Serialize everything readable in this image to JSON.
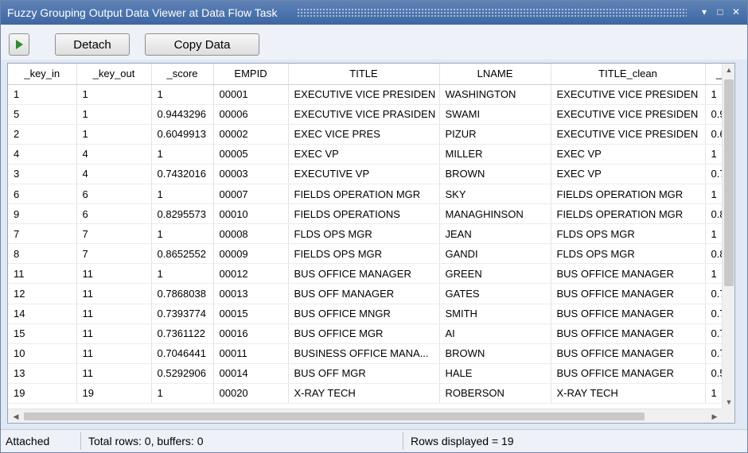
{
  "window": {
    "title": "Fuzzy Grouping Output Data Viewer at Data Flow Task",
    "controls": {
      "dropdown": "▾",
      "maximize": "□",
      "close": "✕"
    }
  },
  "toolbar": {
    "detach_label": "Detach",
    "copy_label": "Copy Data"
  },
  "grid": {
    "columns": [
      "_key_in",
      "_key_out",
      "_score",
      "EMPID",
      "TITLE",
      "LNAME",
      "TITLE_clean",
      "_S"
    ],
    "rows": [
      [
        "1",
        "1",
        "1",
        "00001",
        "EXECUTIVE VICE PRESIDEN",
        "WASHINGTON",
        "EXECUTIVE VICE PRESIDEN",
        "1"
      ],
      [
        "5",
        "1",
        "0.9443296",
        "00006",
        "EXECUTIVE VICE PRASIDEN",
        "SWAMI",
        "EXECUTIVE VICE PRESIDEN",
        "0.9"
      ],
      [
        "2",
        "1",
        "0.6049913",
        "00002",
        "EXEC VICE PRES",
        "PIZUR",
        "EXECUTIVE VICE PRESIDEN",
        "0.6"
      ],
      [
        "4",
        "4",
        "1",
        "00005",
        "EXEC VP",
        "MILLER",
        "EXEC VP",
        "1"
      ],
      [
        "3",
        "4",
        "0.7432016",
        "00003",
        "EXECUTIVE VP",
        "BROWN",
        "EXEC VP",
        "0.7"
      ],
      [
        "6",
        "6",
        "1",
        "00007",
        "FIELDS OPERATION MGR",
        "SKY",
        "FIELDS OPERATION MGR",
        "1"
      ],
      [
        "9",
        "6",
        "0.8295573",
        "00010",
        "FIELDS OPERATIONS",
        "MANAGHINSON",
        "FIELDS OPERATION MGR",
        "0.8"
      ],
      [
        "7",
        "7",
        "1",
        "00008",
        "FLDS OPS MGR",
        "JEAN",
        "FLDS OPS MGR",
        "1"
      ],
      [
        "8",
        "7",
        "0.8652552",
        "00009",
        "FIELDS OPS MGR",
        "GANDI",
        "FLDS OPS MGR",
        "0.8"
      ],
      [
        "11",
        "11",
        "1",
        "00012",
        "BUS OFFICE MANAGER",
        "GREEN",
        "BUS OFFICE MANAGER",
        "1"
      ],
      [
        "12",
        "11",
        "0.7868038",
        "00013",
        "BUS OFF MANAGER",
        "GATES",
        "BUS OFFICE MANAGER",
        "0.7"
      ],
      [
        "14",
        "11",
        "0.7393774",
        "00015",
        "BUS OFFICE MNGR",
        "SMITH",
        "BUS OFFICE MANAGER",
        "0.7"
      ],
      [
        "15",
        "11",
        "0.7361122",
        "00016",
        "BUS OFFICE MGR",
        "AI",
        "BUS OFFICE MANAGER",
        "0.7"
      ],
      [
        "10",
        "11",
        "0.7046441",
        "00011",
        "BUSINESS OFFICE MANA...",
        "BROWN",
        "BUS OFFICE MANAGER",
        "0.7"
      ],
      [
        "13",
        "11",
        "0.5292906",
        "00014",
        "BUS OFF MGR",
        "HALE",
        "BUS OFFICE MANAGER",
        "0.5"
      ],
      [
        "19",
        "19",
        "1",
        "00020",
        "X-RAY TECH",
        "ROBERSON",
        "X-RAY TECH",
        "1"
      ]
    ]
  },
  "status": {
    "state": "Attached",
    "totals": "Total rows: 0, buffers: 0",
    "displayed": "Rows displayed = 19"
  },
  "colors": {
    "titlebar": "#4a72ad",
    "play_icon": "#2e8b2e",
    "window_bg": "#dfe8f4"
  }
}
